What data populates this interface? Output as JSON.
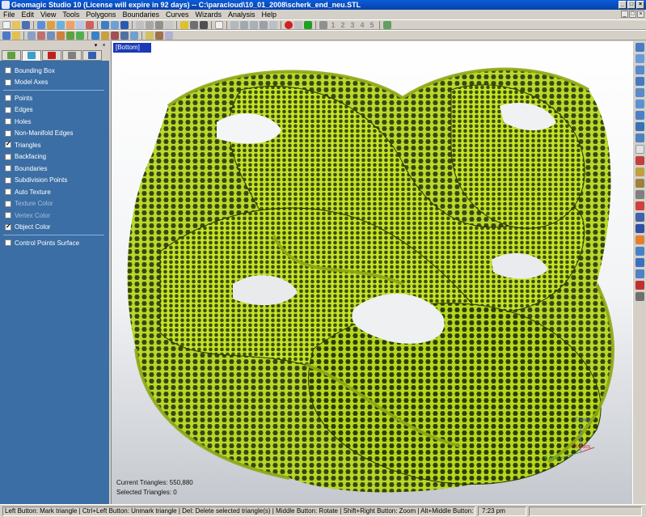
{
  "window": {
    "title": "Geomagic Studio 10 (License will expire in 92 days) -- C:\\paracloud\\10_01_2008\\scherk_end_neu.STL",
    "controls": [
      "_",
      "□",
      "×"
    ]
  },
  "menu": {
    "items": [
      "File",
      "Edit",
      "View",
      "Tools",
      "Polygons",
      "Boundaries",
      "Curves",
      "Wizards",
      "Analysis",
      "Help"
    ],
    "controls": [
      "_",
      "□",
      "×"
    ]
  },
  "toolbar2": {
    "numbers": [
      "1",
      "2",
      "3",
      "4",
      "5"
    ]
  },
  "left_panel": {
    "close": "×",
    "pin": "▾",
    "tabs": [
      "display-tab",
      "object-tab",
      "color-tab",
      "view-tab",
      "settings-tab"
    ],
    "groups": [
      [
        {
          "label": "Bounding Box",
          "checked": false,
          "enabled": true
        },
        {
          "label": "Model Axes",
          "checked": false,
          "enabled": true
        }
      ],
      [
        {
          "label": "Points",
          "checked": false,
          "enabled": true
        },
        {
          "label": "Edges",
          "checked": false,
          "enabled": true
        },
        {
          "label": "Holes",
          "checked": false,
          "enabled": true
        },
        {
          "label": "Non-Manifold Edges",
          "checked": false,
          "enabled": true
        },
        {
          "label": "Triangles",
          "checked": true,
          "enabled": true
        },
        {
          "label": "Backfacing",
          "checked": false,
          "enabled": true
        },
        {
          "label": "Boundaries",
          "checked": false,
          "enabled": true
        },
        {
          "label": "Subdivision Points",
          "checked": false,
          "enabled": true
        },
        {
          "label": "Auto Texture",
          "checked": false,
          "enabled": true
        },
        {
          "label": "Texture Color",
          "checked": false,
          "enabled": false
        },
        {
          "label": "Vertex Color",
          "checked": false,
          "enabled": false
        },
        {
          "label": "Object Color",
          "checked": true,
          "enabled": true
        }
      ],
      [
        {
          "label": "Control Points Surface",
          "checked": false,
          "enabled": true
        }
      ]
    ]
  },
  "viewport": {
    "view_name": "[Bottom]",
    "current_triangles_label": "Current Triangles: 550,880",
    "selected_triangles_label": "Selected Triangles: 0",
    "axes": {
      "z": "Z-Axis",
      "x": "X-Axis",
      "y": "Y-Axis"
    },
    "mesh_color": "#b5d71f",
    "mesh_shadow_color": "#3d4f06"
  },
  "status_bar": {
    "message": "Left Button: Mark triangle | Ctrl+Left Button: Unmark triangle | Del: Delete selected triangle(s) | Middle Button: Rotate | Shift+Right Button: Zoom | Alt+Middle Button: Pan",
    "time": "7:23 pm"
  }
}
